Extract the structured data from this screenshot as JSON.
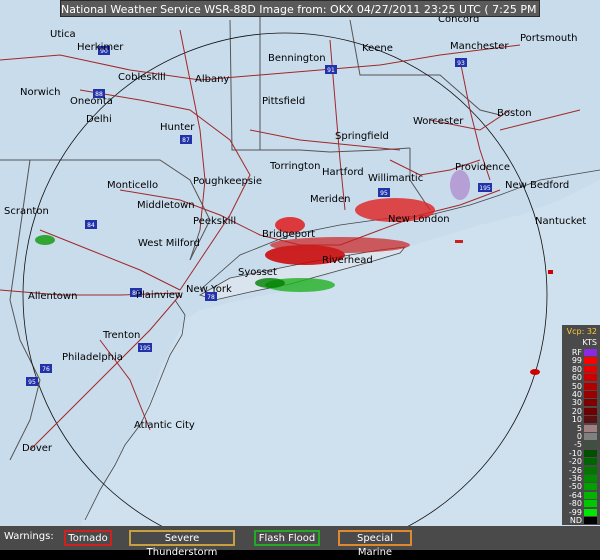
{
  "title": "National Weather Service WSR-88D Image from: OKX 04/27/2011 23:25 UTC ( 7:25 PM EDT)",
  "colors": {
    "background": "#c9dcec",
    "roads_interstate": "#8b1a1a",
    "roads_us": "#b03030",
    "borders": "#555555",
    "range_ring": "#000000"
  },
  "cities": [
    {
      "name": "Utica"
    },
    {
      "name": "Herkimer"
    },
    {
      "name": "Concord"
    },
    {
      "name": "Portsmouth"
    },
    {
      "name": "Bennington"
    },
    {
      "name": "Keene"
    },
    {
      "name": "Manchester"
    },
    {
      "name": "Cobleskill"
    },
    {
      "name": "Albany"
    },
    {
      "name": "Norwich"
    },
    {
      "name": "Oneonta"
    },
    {
      "name": "Delhi"
    },
    {
      "name": "Pittsfield"
    },
    {
      "name": "Worcester"
    },
    {
      "name": "Boston"
    },
    {
      "name": "Hunter"
    },
    {
      "name": "Springfield"
    },
    {
      "name": "Providence"
    },
    {
      "name": "Torrington"
    },
    {
      "name": "Hartford"
    },
    {
      "name": "Willimantic"
    },
    {
      "name": "New Bedford"
    },
    {
      "name": "Monticello"
    },
    {
      "name": "Poughkeepsie"
    },
    {
      "name": "Meriden"
    },
    {
      "name": "Middletown"
    },
    {
      "name": "Scranton"
    },
    {
      "name": "New London"
    },
    {
      "name": "Nantucket"
    },
    {
      "name": "Peekskill"
    },
    {
      "name": "Bridgeport"
    },
    {
      "name": "West Milford"
    },
    {
      "name": "Riverhead"
    },
    {
      "name": "Syosset"
    },
    {
      "name": "Allentown"
    },
    {
      "name": "Plainview"
    },
    {
      "name": "New York"
    },
    {
      "name": "Trenton"
    },
    {
      "name": "Philadelphia"
    },
    {
      "name": "Atlantic City"
    },
    {
      "name": "Dover"
    }
  ],
  "interstates": [
    "90",
    "93",
    "88",
    "87",
    "91",
    "95",
    "84",
    "80",
    "195",
    "78",
    "195",
    "76",
    "95"
  ],
  "legend": {
    "header": "Vcp: 32",
    "units": "KTS",
    "rows": [
      {
        "label": "RF",
        "color": "#8a2be2"
      },
      {
        "label": "99",
        "color": "#ff0000"
      },
      {
        "label": "80",
        "color": "#e60000"
      },
      {
        "label": "60",
        "color": "#cc0000"
      },
      {
        "label": "50",
        "color": "#b00000"
      },
      {
        "label": "40",
        "color": "#990000"
      },
      {
        "label": "30",
        "color": "#800000"
      },
      {
        "label": "20",
        "color": "#700000"
      },
      {
        "label": "10",
        "color": "#5a1010"
      },
      {
        "label": "5",
        "color": "#a08080"
      },
      {
        "label": "0",
        "color": "#808080"
      },
      {
        "label": "-5",
        "color": "#405040"
      },
      {
        "label": "-10",
        "color": "#005000"
      },
      {
        "label": "-20",
        "color": "#006400"
      },
      {
        "label": "-26",
        "color": "#007800"
      },
      {
        "label": "-36",
        "color": "#008c00"
      },
      {
        "label": "-50",
        "color": "#00a000"
      },
      {
        "label": "-64",
        "color": "#00b400"
      },
      {
        "label": "-80",
        "color": "#00c800"
      },
      {
        "label": "-99",
        "color": "#00e600"
      },
      {
        "label": "ND",
        "color": "#000000"
      }
    ]
  },
  "warnings": {
    "label": "Warnings:",
    "items": [
      {
        "text": "Tornado",
        "color": "#cc2222"
      },
      {
        "text": "Severe Thunderstorm",
        "color": "#c8a040"
      },
      {
        "text": "Flash Flood",
        "color": "#22aa22"
      },
      {
        "text": "Special Marine",
        "color": "#e08830"
      }
    ]
  }
}
